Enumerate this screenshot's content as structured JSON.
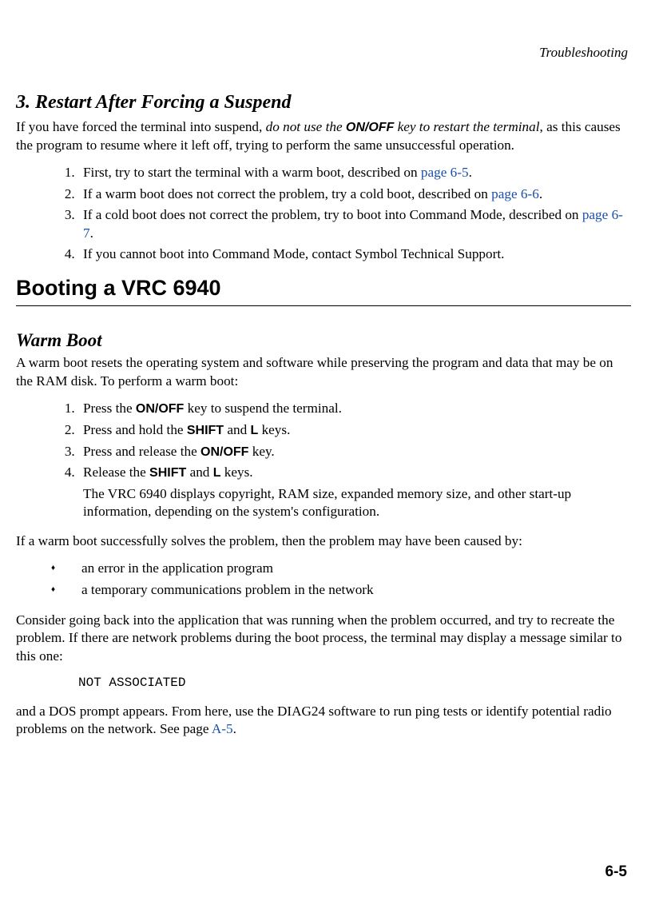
{
  "running_head": "Troubleshooting",
  "section3": {
    "title": "3. Restart After Forcing a Suspend",
    "intro_a": "If you have forced the terminal into suspend, ",
    "intro_emph": "do not use the ",
    "intro_key": "ON/OFF",
    "intro_emph2": " key to restart the terminal",
    "intro_b": ", as this causes the program to resume where it left off, trying to perform the same unsuccessful operation.",
    "steps": [
      {
        "pre": "First, try to start the terminal with a warm boot, described on ",
        "link": "page 6-5",
        "post": "."
      },
      {
        "pre": "If a warm boot does not correct the problem, try a cold boot, described on ",
        "link": "page 6-6",
        "post": "."
      },
      {
        "pre": "If a cold boot does not correct the problem, try to boot into Command Mode, described on ",
        "link": "page 6-7",
        "post": "."
      },
      {
        "pre": "If you cannot boot into Command Mode, contact Symbol Technical Support.",
        "link": "",
        "post": ""
      }
    ]
  },
  "h1": "Booting a VRC 6940",
  "warm": {
    "title": "Warm Boot",
    "intro": "A warm boot resets the operating system and software while preserving the program and data that may be on the RAM disk. To perform a warm boot:",
    "steps": {
      "s1a": "Press the ",
      "s1key": "ON/OFF",
      "s1b": " key to suspend the terminal.",
      "s2a": "Press and hold the ",
      "s2k1": "SHIFT",
      "s2mid": " and ",
      "s2k2": "L",
      "s2b": " keys.",
      "s3a": "Press and release the ",
      "s3key": "ON/OFF",
      "s3b": " key.",
      "s4a": "Release the ",
      "s4k1": "SHIFT",
      "s4mid": " and ",
      "s4k2": "L",
      "s4b": " keys.",
      "s4note": "The VRC 6940 displays copyright, RAM size, expanded memory size, and other start-up information, depending on the system's configuration."
    },
    "after": "If a warm boot successfully solves the problem, then the problem may have been caused by:",
    "bullets": [
      "an error in the application program",
      "a temporary communications problem in the network"
    ],
    "consider": "Consider going back into the application that was running when the problem occurred, and try to recreate the problem. If there are network problems during the boot process, the terminal may display a message similar to this one:",
    "code": "NOT ASSOCIATED",
    "dos_a": "and a DOS prompt appears. From here, use the DIAG24 software to run ping tests or identify potential radio problems on the network. See page ",
    "dos_link": "A-5",
    "dos_b": "."
  },
  "page_number": "6-5"
}
